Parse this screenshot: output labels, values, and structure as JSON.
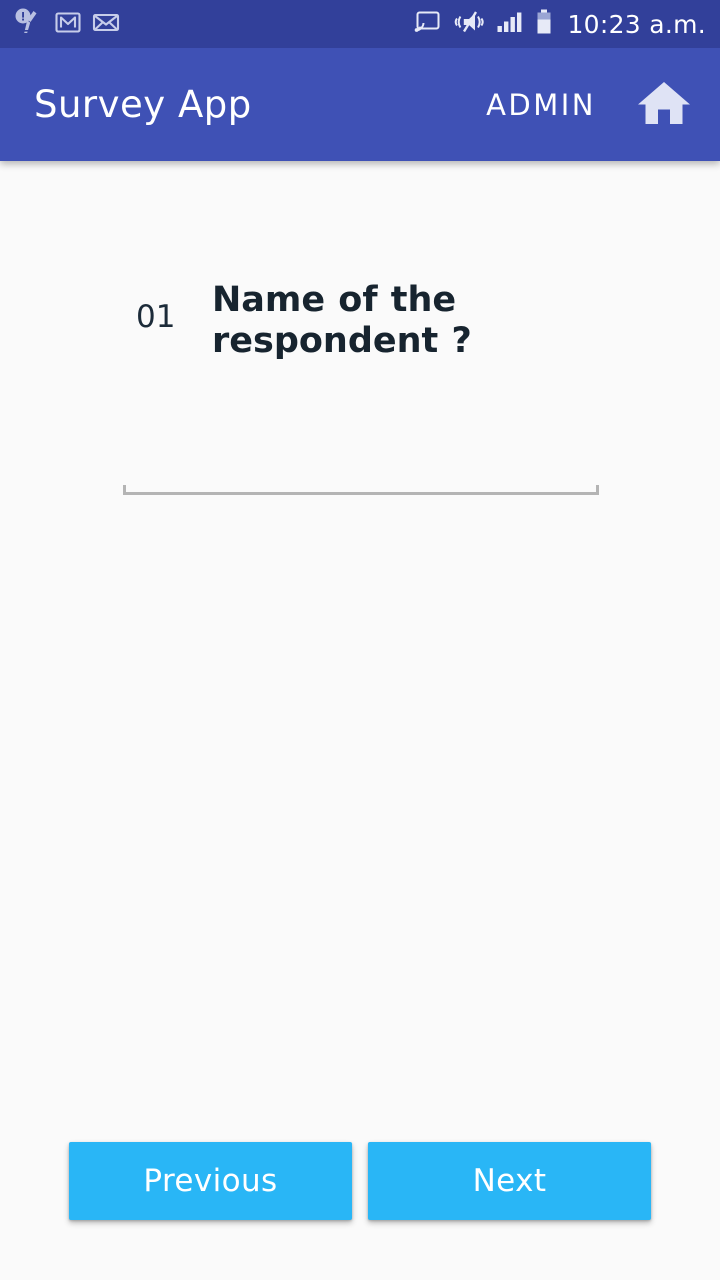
{
  "status_bar": {
    "background": "#32409a",
    "time": "10:23 a.m.",
    "left_icons": [
      {
        "name": "cleaner-alert-icon",
        "label": "Cleaner alert"
      },
      {
        "name": "gmail-icon",
        "label": "Gmail"
      },
      {
        "name": "email-icon",
        "label": "Email"
      }
    ],
    "right_icons": [
      {
        "name": "cast-icon",
        "label": "Cast"
      },
      {
        "name": "vibrate-mute-icon",
        "label": "Sound off / vibrate"
      },
      {
        "name": "signal-icon",
        "label": "Signal"
      },
      {
        "name": "battery-icon",
        "label": "Battery"
      }
    ]
  },
  "app_bar": {
    "background": "#3f51b5",
    "title": "Survey App",
    "admin_label": "ADMIN",
    "home_icon": "home-icon"
  },
  "survey": {
    "question_number": "01",
    "question_text": "Name of the respondent ?",
    "answer_value": "",
    "answer_placeholder": ""
  },
  "navigation": {
    "previous_label": "Previous",
    "next_label": "Next",
    "button_color": "#29b6f6"
  },
  "theme": {
    "page_background": "#fafafa",
    "question_text_color": "#17242f",
    "underline_color": "#b4b4b4"
  }
}
